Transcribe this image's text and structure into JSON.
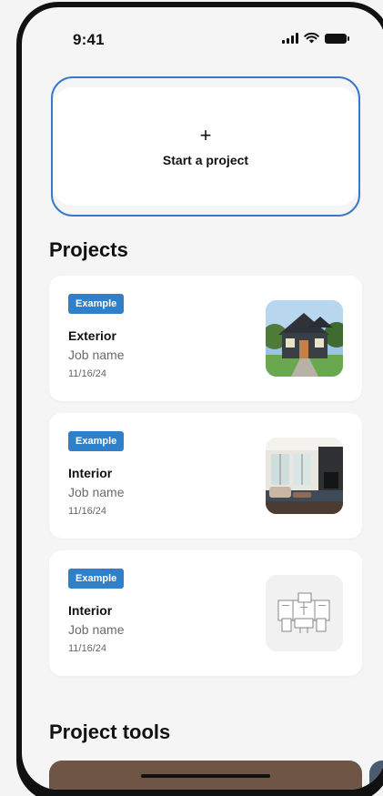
{
  "status_bar": {
    "time": "9:41"
  },
  "start_project": {
    "plus": "+",
    "label": "Start a project"
  },
  "sections": {
    "projects": "Projects",
    "tools": "Project tools"
  },
  "projects": [
    {
      "badge": "Example",
      "title": "Exterior",
      "job": "Job name",
      "date": "11/16/24",
      "thumbnail": "house-exterior-photo"
    },
    {
      "badge": "Example",
      "title": "Interior",
      "job": "Job name",
      "date": "11/16/24",
      "thumbnail": "living-room-photo"
    },
    {
      "badge": "Example",
      "title": "Interior",
      "job": "Job name",
      "date": "11/16/24",
      "thumbnail": "floor-plan-drawing"
    }
  ],
  "colors": {
    "accent_border": "#3a78c9",
    "badge": "#2f80c8",
    "tools_card": "#6e5545",
    "tools_card_2": "#4a5a70"
  }
}
